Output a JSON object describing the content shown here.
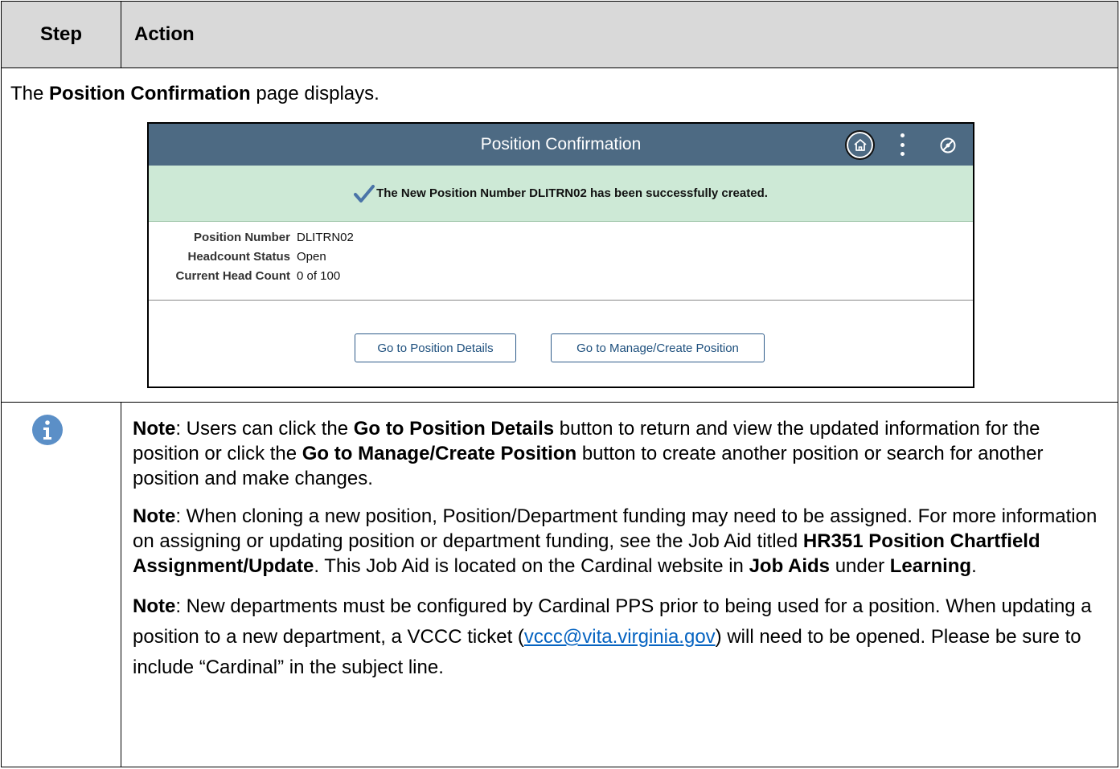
{
  "header": {
    "step": "Step",
    "action": "Action"
  },
  "intro": {
    "prefix": "The ",
    "page_name": "Position Confirmation",
    "suffix": " page displays."
  },
  "screenshot": {
    "title": "Position Confirmation",
    "header_color": "#4d6a83",
    "banner_color": "#cde9d6",
    "icons": [
      "home-icon",
      "more-vertical-icon",
      "navbar-icon"
    ],
    "success_message": "The New Position Number DLITRN02 has been successfully created.",
    "fields": [
      {
        "label": "Position Number",
        "value": "DLITRN02"
      },
      {
        "label": "Headcount Status",
        "value": "Open"
      },
      {
        "label": "Current Head Count",
        "value": "0 of 100"
      }
    ],
    "buttons": {
      "position_details": "Go to Position Details",
      "manage_create": "Go to Manage/Create Position"
    }
  },
  "notes": {
    "icon": "info-icon",
    "n1": {
      "label": "Note",
      "t1": ": Users can click the ",
      "b1": "Go to Position Details",
      "t2": " button to return and view the updated information for the position or click the ",
      "b2": "Go to Manage/Create Position",
      "t3": " button to create another position or search for another position and make changes."
    },
    "n2": {
      "label": "Note",
      "t1": ": When cloning a new position, Position/Department  funding may need to be assigned. For more information on assigning or updating position or department funding, see the Job Aid titled ",
      "b1": "HR351 Position Chartfield Assignment/Update",
      "t2": ". This Job Aid is located on the Cardinal website in ",
      "b2": "Job Aids",
      "t3": " under ",
      "b3": "Learning",
      "t4": "."
    },
    "n3": {
      "label": "Note",
      "t1": ": New departments must be configured by Cardinal PPS prior to being used for a position. When updating a position to a new department, a VCCC ticket (",
      "link": "vccc@vita.virginia.gov",
      "t2": ")  will need to be opened. Please be sure to include “Cardinal” in the subject line."
    }
  }
}
